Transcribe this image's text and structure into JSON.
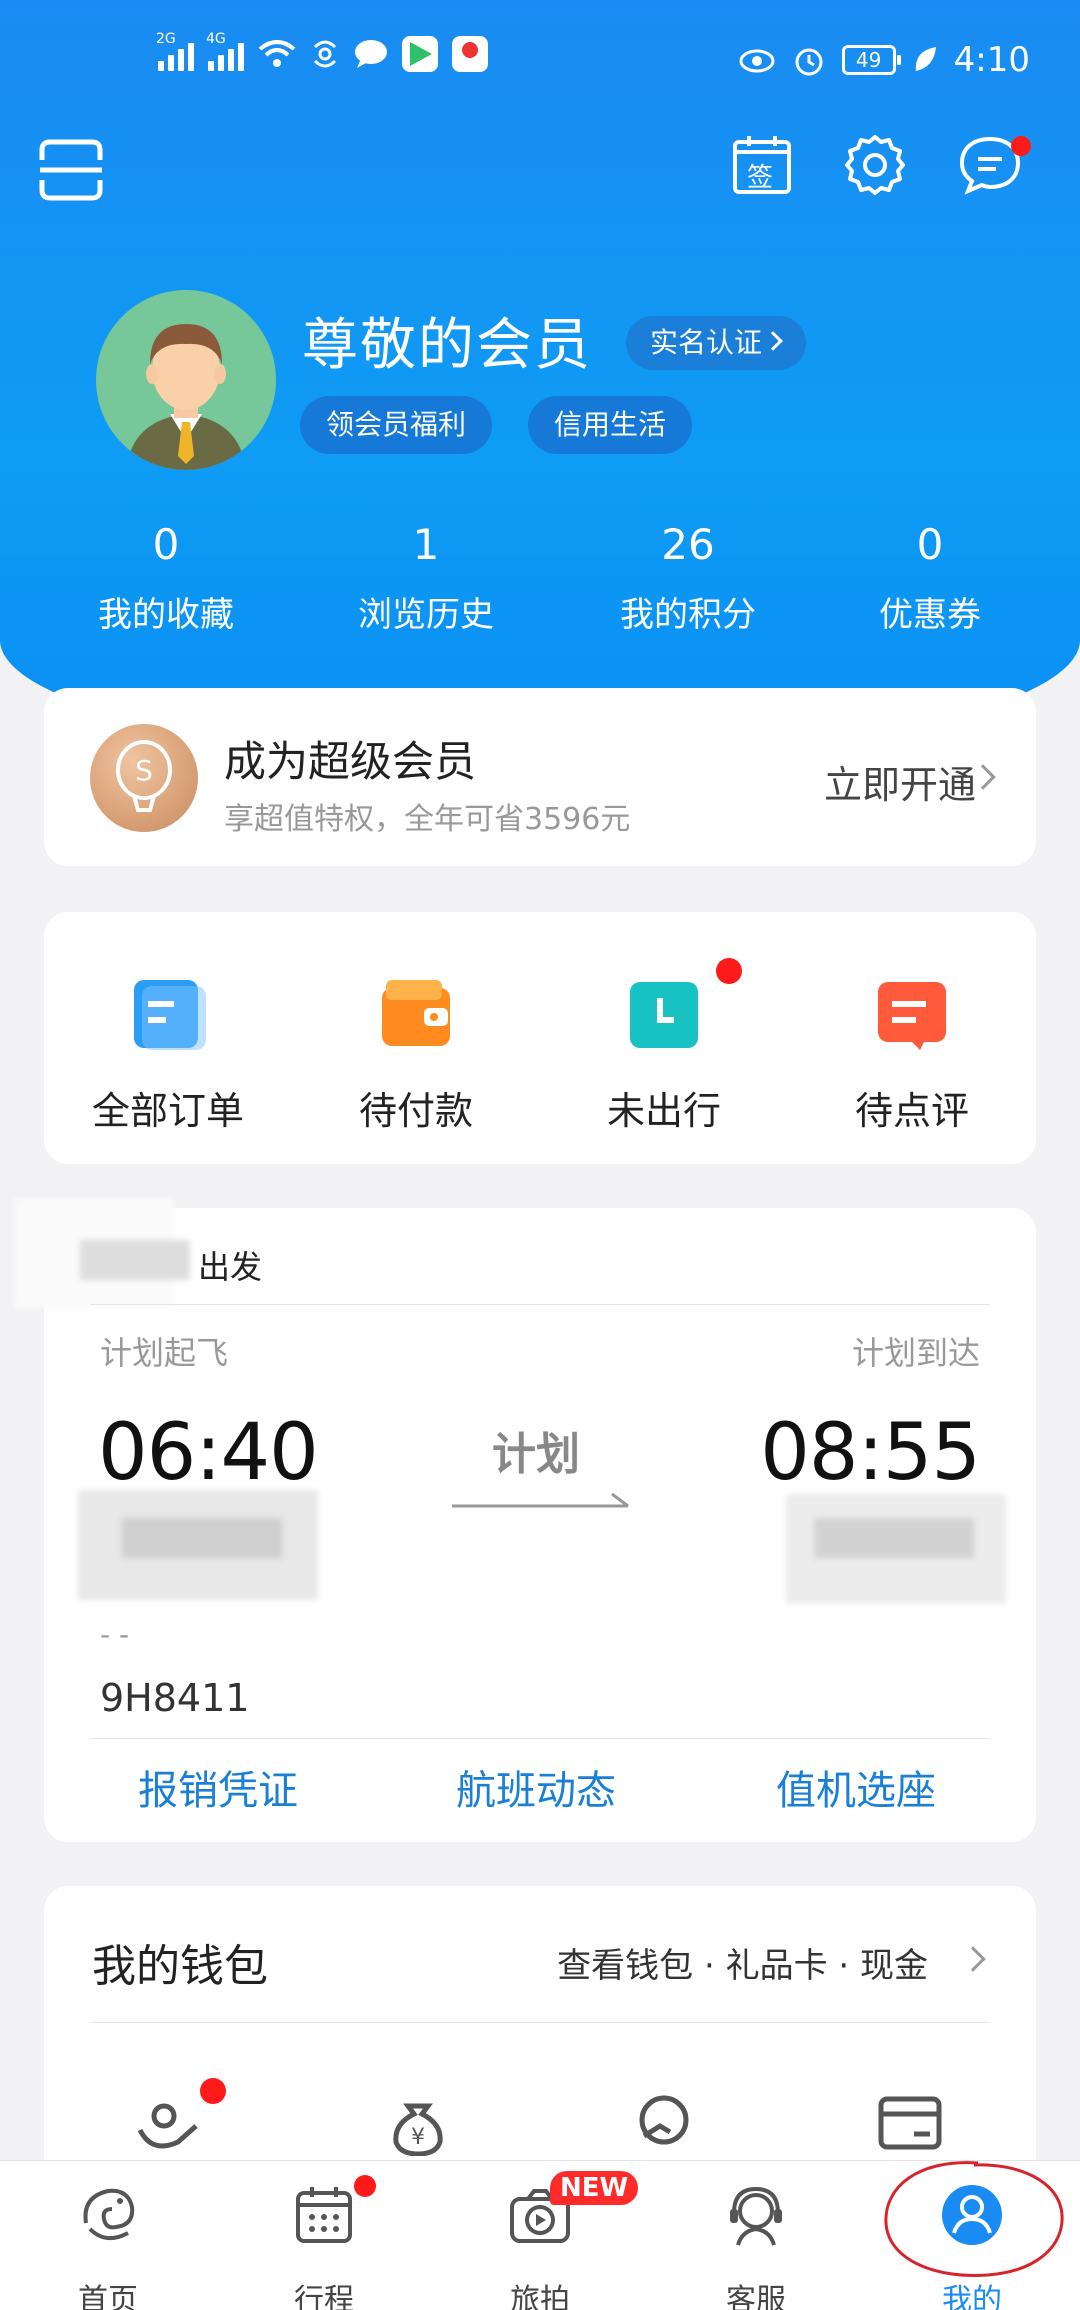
{
  "status_bar": {
    "left_signal_1": "2G",
    "left_signal_2": "4G",
    "battery": "49",
    "time": "4:10"
  },
  "header": {
    "icons": [
      "scan-icon",
      "sign-in-calendar-icon",
      "settings-gear-icon",
      "message-icon"
    ],
    "sign_label": "签"
  },
  "profile": {
    "name": "尊敬的会员",
    "verify_label": "实名认证",
    "benefit_pill": "领会员福利",
    "credit_pill": "信用生活"
  },
  "stats": [
    {
      "value": "0",
      "label": "我的收藏"
    },
    {
      "value": "1",
      "label": "浏览历史"
    },
    {
      "value": "26",
      "label": "我的积分"
    },
    {
      "value": "0",
      "label": "优惠券"
    }
  ],
  "vip": {
    "title": "成为超级会员",
    "subtitle": "享超值特权，全年可省3596元",
    "action": "立即开通"
  },
  "orders": [
    {
      "label": "全部订单",
      "color": "#2a9df4"
    },
    {
      "label": "待付款",
      "color": "#ff8a1f"
    },
    {
      "label": "未出行",
      "color": "#19c2c2"
    },
    {
      "label": "待点评",
      "color": "#ff5a3c"
    }
  ],
  "trip": {
    "depart_suffix": "出发",
    "plan_depart_label": "计划起飞",
    "plan_arrive_label": "计划到达",
    "depart_time": "06:40",
    "arrive_time": "08:55",
    "status": "计划",
    "dashes": "- -",
    "flight_no": "9H8411",
    "links": [
      "报销凭证",
      "航班动态",
      "值机选座"
    ]
  },
  "wallet": {
    "title": "我的钱包",
    "links": "查看钱包 · 礼品卡 · 现金"
  },
  "tabbar": [
    {
      "label": "首页",
      "active": false
    },
    {
      "label": "行程",
      "active": false
    },
    {
      "label": "旅拍",
      "active": false,
      "badge": "NEW"
    },
    {
      "label": "客服",
      "active": false
    },
    {
      "label": "我的",
      "active": true
    }
  ],
  "colors": {
    "brand_blue": "#1a8bf2",
    "link_blue": "#1a7fd6",
    "alert_red": "#ff1a1a"
  }
}
